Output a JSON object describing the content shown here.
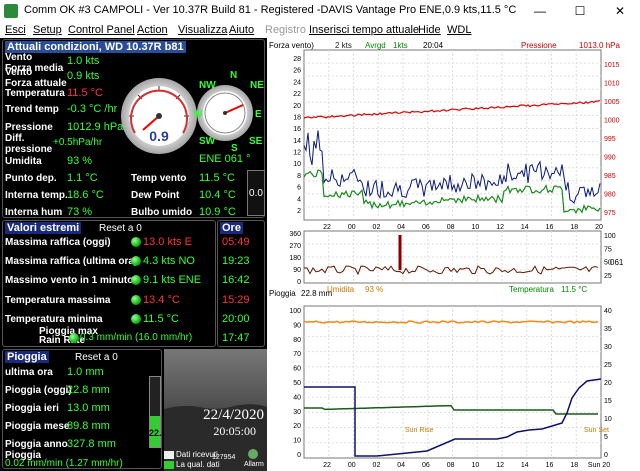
{
  "titlebar": {
    "text": "Comm OK  #3 CAMPOLI - Ver 10.37R Build 81 - Registered  -DAVIS Vantage Pro ENE,0.9 kts,11.5 °C",
    "min": "—",
    "max": "☐",
    "close": "✕"
  },
  "menu": [
    {
      "label": "Esci",
      "enabled": true
    },
    {
      "label": "Setup",
      "enabled": true
    },
    {
      "label": "Control Panel",
      "enabled": true
    },
    {
      "label": "Action",
      "enabled": true
    },
    {
      "label": "Visualizza",
      "enabled": true
    },
    {
      "label": "Aiuto",
      "enabled": true
    },
    {
      "label": "Registro",
      "enabled": false
    },
    {
      "label": "Inserisci tempo attuale",
      "enabled": true
    },
    {
      "label": "Hide",
      "enabled": true
    },
    {
      "label": "WDL",
      "enabled": true
    }
  ],
  "current": {
    "title": "Attuali condizioni, WD 10.37R b81",
    "vento_label": "Vento\nForza media",
    "vento": "1.0 kts",
    "vento_att_label": "Vento\nForza attuale",
    "vento_att": "0.9 kts",
    "temp_label": "Temperatura",
    "temp": "11.5 °C",
    "trend_label": "Trend temp",
    "trend": "-0.3 °C /hr",
    "press_label": "Pressione",
    "press": "1012.9 hPa",
    "diff_label": "Diff.\npressione",
    "diff": "+0.5hPa/hr",
    "umid_label": "Umidita",
    "umid": "93 %",
    "dew_label": "Punto dep.",
    "dew": "1.1 °C",
    "int_temp_label": "Interna temp.",
    "int_temp": "18.6 °C",
    "int_hum_label": "Interna hum",
    "int_hum": "73 %",
    "tvento_label": "Temp vento",
    "tvento": "11.5 °C",
    "dewpoint_label": "Dew Point",
    "dewpoint": "10.4 °C",
    "bulbo_label": "Bulbo umido",
    "bulbo": "10.9 °C",
    "dir": "ENE  061 °",
    "gauge_val": "0.9",
    "side_val": "0.0",
    "compass": [
      "N",
      "NE",
      "E",
      "SE",
      "S",
      "SW",
      "W",
      "NW"
    ]
  },
  "extremes": {
    "title": "Valori estremi",
    "reset": "Reset a 0",
    "ore_title": "Ore",
    "rows": [
      {
        "label": "Massima raffica (oggi)",
        "value": "13.0 kts  E",
        "color": "#ff3333",
        "time": "05:49",
        "tcolor": "#ff3333"
      },
      {
        "label": "Massima raffica (ultima ora)",
        "value": "4.3 kts  NO",
        "color": "#33ff33",
        "time": "19:23",
        "tcolor": "#33ff33"
      },
      {
        "label": "Massimo vento in 1 minuto",
        "value": "9.1 kts ENE",
        "color": "#33ff33",
        "time": "16:42",
        "tcolor": "#33ff33"
      },
      {
        "label": "Temperatura massima",
        "value": "13.4 °C",
        "color": "#ff3333",
        "time": "15:29",
        "tcolor": "#ff3333"
      },
      {
        "label": "Temperatura minima",
        "value": "11.5 °C",
        "color": "#33ff33",
        "time": "20:00",
        "tcolor": "#33ff33"
      },
      {
        "label": "Pioggia max\nRain Rate",
        "value": "0.3 mm/min (16.0 mm/hr)",
        "color": "#33ff33",
        "time": "17:47",
        "tcolor": "#33ff33"
      }
    ]
  },
  "rain": {
    "title": "Pioggia",
    "reset": "Reset a 0",
    "rows": [
      {
        "label": "ultima ora",
        "value": "1.0 mm"
      },
      {
        "label": "Pioggia (oggi)",
        "value": "22.8 mm"
      },
      {
        "label": "Pioggia ieri",
        "value": "13.0 mm"
      },
      {
        "label": "Pioggia mese",
        "value": "89.8 mm"
      },
      {
        "label": "Pioggia anno",
        "value": "327.8 mm"
      }
    ],
    "rate_label": "Pioggia",
    "rate": "0.02 mm/min (1.27 mm/hr)",
    "bar_val": "22.8",
    "bar_fill": 0.45
  },
  "camera": {
    "date": "22/4/2020",
    "time": "20:05:00",
    "count": "127954",
    "dati_ricevuti": "Dati ricevuti",
    "qual_dati": "La qual. dati",
    "allarm": "Allarm"
  },
  "graph1": {
    "header": [
      "Forza vento)",
      "2 kts",
      "Avrgd",
      "1kts",
      "20:04",
      "Pressione",
      "1013.0 hPa"
    ],
    "yleft": [
      "28",
      "26",
      "24",
      "22",
      "20",
      "18",
      "16",
      "14",
      "12",
      "10",
      "8",
      "6",
      "4",
      "2"
    ],
    "yright": [
      "1015",
      "1010",
      "1005",
      "1000",
      "995",
      "990",
      "985",
      "980",
      "975"
    ],
    "x": [
      "22",
      "00",
      "02",
      "04",
      "06",
      "08",
      "10",
      "12",
      "14",
      "16",
      "18",
      "20"
    ]
  },
  "graph2": {
    "yleft": [
      "360",
      "270",
      "180",
      "90",
      "0"
    ],
    "yright": [
      "100",
      "75",
      "50",
      "25"
    ],
    "right_label": "061",
    "umid_label": "Umidita",
    "umid": "93 %",
    "temp_label": "Temperatura",
    "temp": "11.5 °C"
  },
  "graph3": {
    "header_label": "Pioggia",
    "header_val": "22.8 mm",
    "yleft": [
      "100",
      "90",
      "80",
      "70",
      "60",
      "50",
      "40",
      "30",
      "20",
      "10",
      "0"
    ],
    "yright": [
      "40",
      "35",
      "30",
      "25",
      "20",
      "15",
      "10",
      "5",
      "0"
    ],
    "x": [
      "22",
      "00",
      "02",
      "04",
      "06",
      "08",
      "10",
      "12",
      "14",
      "16",
      "18",
      "Sun 20"
    ],
    "sun_rise": "Sun Rise",
    "sun_set": "Sun Set"
  }
}
